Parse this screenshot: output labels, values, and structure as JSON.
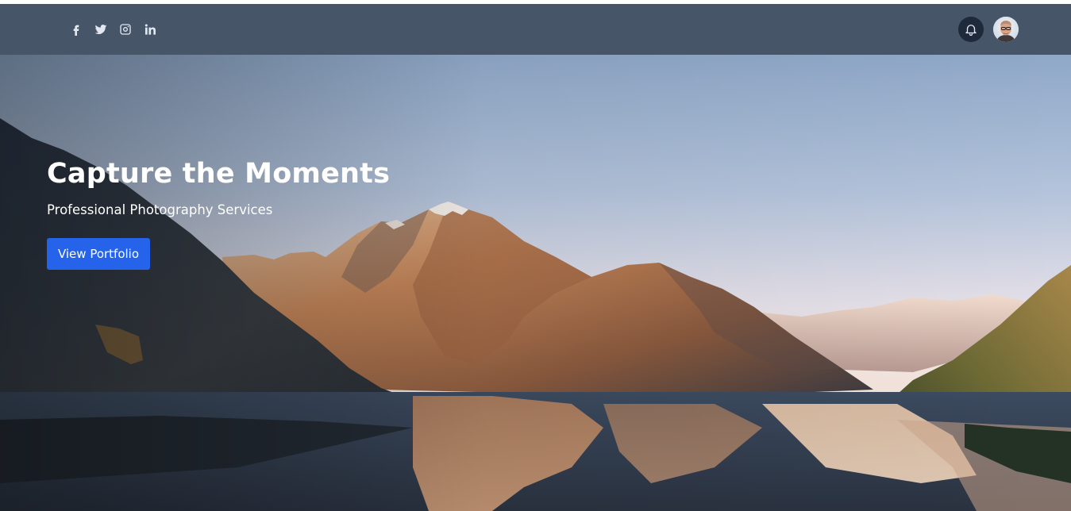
{
  "navbar": {
    "social_links": [
      {
        "icon": "facebook-icon"
      },
      {
        "icon": "twitter-icon"
      },
      {
        "icon": "instagram-icon"
      },
      {
        "icon": "linkedin-icon"
      }
    ],
    "notification_icon": "bell-icon",
    "avatar_icon": "user-avatar"
  },
  "hero": {
    "title": "Capture the Moments",
    "subtitle": "Professional Photography Services",
    "cta_label": "View Portfolio"
  },
  "colors": {
    "navbar_bg": "#475569",
    "button_bg": "#2563eb",
    "bell_bg": "#1e293b"
  }
}
